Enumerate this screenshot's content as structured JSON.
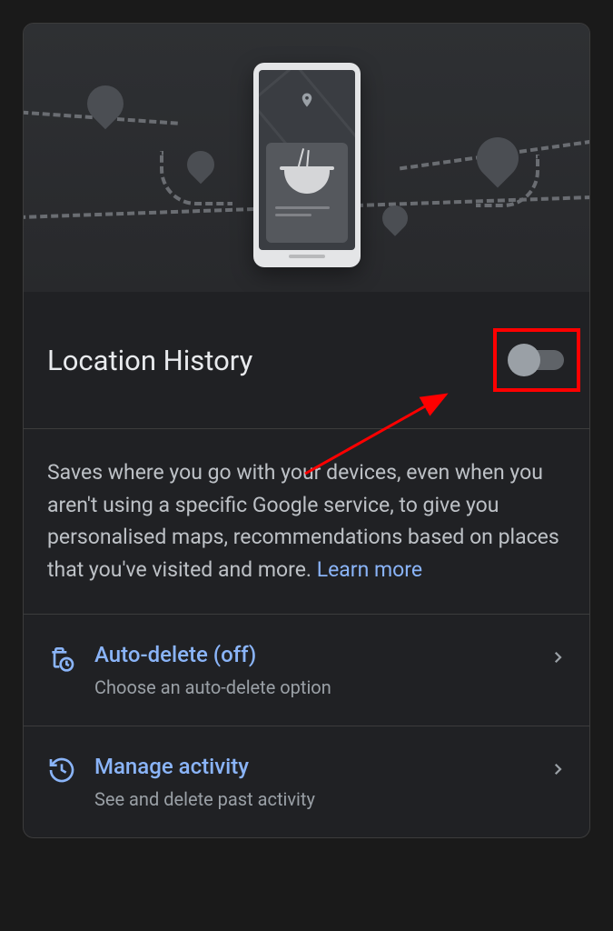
{
  "header": {
    "title": "Location History"
  },
  "toggle": {
    "state": "off"
  },
  "description": {
    "text": "Saves where you go with your devices, even when you aren't using a specific Google service, to give you personalised maps, recommendations based on places that you've visited and more. ",
    "learn_more": "Learn more"
  },
  "actions": {
    "auto_delete": {
      "title": "Auto-delete (off)",
      "subtitle": "Choose an auto-delete option"
    },
    "manage_activity": {
      "title": "Manage activity",
      "subtitle": "See and delete past activity"
    }
  }
}
